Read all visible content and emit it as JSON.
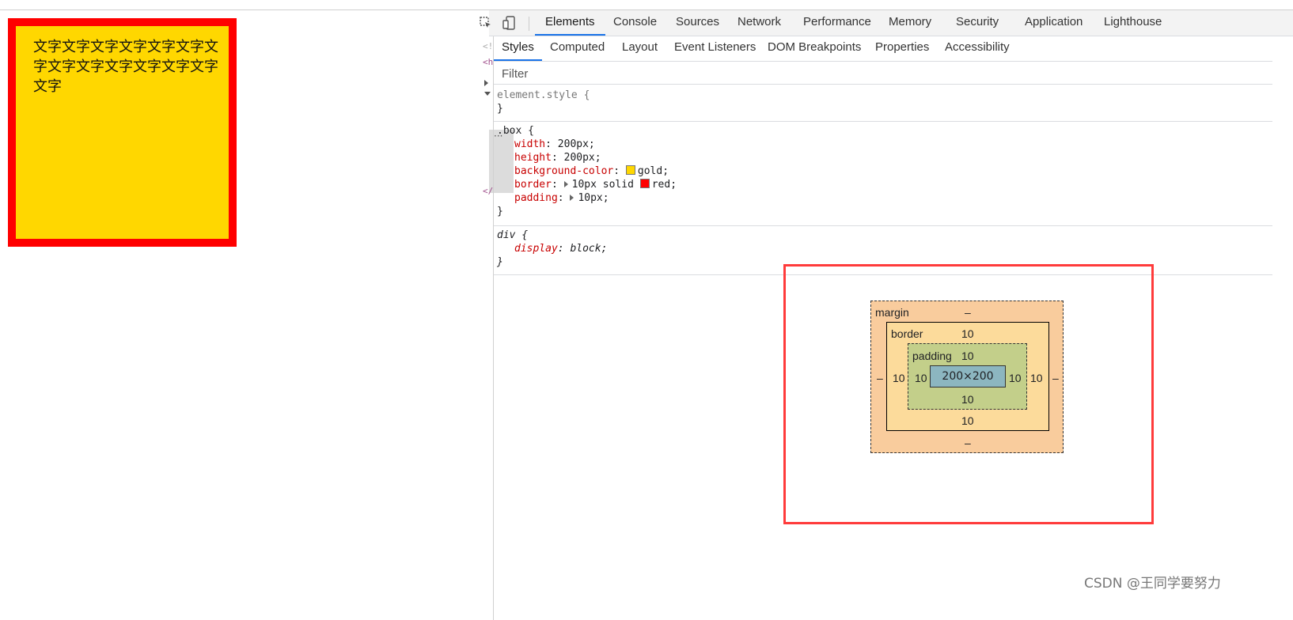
{
  "page": {
    "box_text": "文字文字文字文字文字文字文字文字文字文字文字文字文字文字"
  },
  "devtools": {
    "top_tabs": [
      "Elements",
      "Console",
      "Sources",
      "Network",
      "Performance",
      "Memory",
      "Security",
      "Application",
      "Lighthouse"
    ],
    "active_top_tab": "Elements",
    "sub_tabs": [
      "Styles",
      "Computed",
      "Layout",
      "Event Listeners",
      "DOM Breakpoints",
      "Properties",
      "Accessibility"
    ],
    "active_sub_tab": "Styles",
    "filter_placeholder": "Filter",
    "dom_gutter": [
      "<!",
      "<h",
      "</"
    ],
    "rules": {
      "element_style": {
        "selector": "element.style {",
        "close": "}"
      },
      "box": {
        "selector": ".box {",
        "decls": [
          {
            "name": "width",
            "value": "200px;"
          },
          {
            "name": "height",
            "value": "200px;"
          },
          {
            "name": "background-color",
            "value": "gold;",
            "swatch": "#ffd700"
          },
          {
            "name": "border",
            "value_pre": "10px solid ",
            "value": "red;",
            "swatch": "#ff0000",
            "expandable": true
          },
          {
            "name": "padding",
            "value": "10px;",
            "expandable": true
          }
        ],
        "close": "}"
      },
      "div": {
        "selector": "div {",
        "decls": [
          {
            "name": "display",
            "value": "block;"
          }
        ],
        "close": "}"
      }
    },
    "box_model": {
      "margin_label": "margin",
      "border_label": "border",
      "padding_label": "padding",
      "margin": {
        "top": "–",
        "right": "–",
        "bottom": "–",
        "left": "–"
      },
      "border": {
        "top": "10",
        "right": "10",
        "bottom": "10",
        "left": "10"
      },
      "padding": {
        "top": "10",
        "right": "10",
        "bottom": "10",
        "left": "10"
      },
      "content": "200×200"
    }
  },
  "watermark": "CSDN @王同学要努力",
  "colors": {
    "highlight": "#ff3b3b",
    "accent": "#1a73e8",
    "box_bg": "#ffd700",
    "box_border": "#ff0000"
  }
}
